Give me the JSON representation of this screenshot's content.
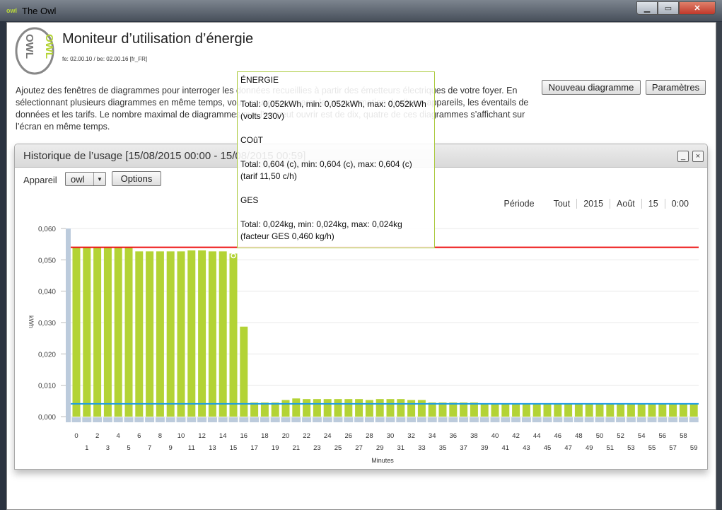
{
  "window": {
    "title": "The Owl",
    "app_icon": "owl-icon",
    "controls": [
      "minimize",
      "maximize",
      "close"
    ]
  },
  "header": {
    "title": "Moniteur d’utilisation d’énergie",
    "version": "fe: 02.00.10 / be: 02.00.16 [fr_FR]",
    "logo_text": "OWL"
  },
  "intro": "Ajoutez des fenêtres de diagrammes pour interroger les données recueillies à partir des émetteurs électriques de votre foyer. En sélectionnant plusieurs diagrammes en même temps, vous pouvez comparer la consommation de divers appareils, les éventails de données et les tarifs. Le nombre maximal de diagrammes que l’on peut ouvrir est de dix, quatre de ces diagrammes s’affichant sur l’écran en même temps.",
  "toolbar": {
    "new_chart": "Nouveau diagramme",
    "settings": "Paramètres"
  },
  "panel": {
    "title": "Historique de l’usage [15/08/2015 00:00 - 15/08/2015 00:59]",
    "minimize": "_",
    "close": "×",
    "device_label": "Appareil",
    "device_value": "owl",
    "options": "Options",
    "period_label": "Période",
    "period_items": [
      "Tout",
      "2015",
      "Août",
      "15",
      "0:00"
    ]
  },
  "tooltip": {
    "energy_title": "ÉNERGIE",
    "energy_line": "Total: 0,052kWh, min: 0,052kWh, max: 0,052kWh",
    "energy_note": "(volts 230v)",
    "cost_title": "COûT",
    "cost_line": "Total: 0,604 (c), min: 0,604 (c), max: 0,604 (c)",
    "cost_note": "(tarif 11,50 c/h)",
    "ghg_title": "GES",
    "ghg_line": "Total: 0,024kg, min: 0,024kg, max: 0,024kg",
    "ghg_note": "(facteur GES 0,460 kg/h)"
  },
  "chart_data": {
    "type": "bar",
    "xlabel": "Minutes",
    "ylabel": "kWh",
    "ylim": [
      0,
      0.06
    ],
    "yticks": [
      "0,000",
      "0,010",
      "0,020",
      "0,030",
      "0,040",
      "0,050",
      "0,060"
    ],
    "categories": [
      0,
      1,
      2,
      3,
      4,
      5,
      6,
      7,
      8,
      9,
      10,
      11,
      12,
      13,
      14,
      15,
      16,
      17,
      18,
      19,
      20,
      21,
      22,
      23,
      24,
      25,
      26,
      27,
      28,
      29,
      30,
      31,
      32,
      33,
      34,
      35,
      36,
      37,
      38,
      39,
      40,
      41,
      42,
      43,
      44,
      45,
      46,
      47,
      48,
      49,
      50,
      51,
      52,
      53,
      54,
      55,
      56,
      57,
      58,
      59
    ],
    "values": [
      0.054,
      0.054,
      0.054,
      0.054,
      0.054,
      0.054,
      0.0527,
      0.0527,
      0.0527,
      0.0527,
      0.0527,
      0.053,
      0.053,
      0.0527,
      0.0527,
      0.052,
      0.0287,
      0.0045,
      0.0045,
      0.0045,
      0.0053,
      0.0058,
      0.0056,
      0.0056,
      0.0056,
      0.0056,
      0.0056,
      0.0056,
      0.0053,
      0.0056,
      0.0056,
      0.0056,
      0.0053,
      0.0053,
      0.0045,
      0.0045,
      0.0045,
      0.0045,
      0.0045,
      0.004,
      0.004,
      0.004,
      0.004,
      0.004,
      0.004,
      0.004,
      0.004,
      0.004,
      0.004,
      0.004,
      0.004,
      0.004,
      0.004,
      0.004,
      0.004,
      0.004,
      0.004,
      0.004,
      0.004,
      0.004
    ],
    "max_line": 0.054,
    "avg_line": 0.0041,
    "selected": 15,
    "colors": {
      "bar": "#b3d335",
      "max_line": "#ee1111",
      "avg_line": "#1a9be6",
      "navigator": "#bccbdc",
      "grid": "#e8e8e8"
    },
    "grid": true
  }
}
